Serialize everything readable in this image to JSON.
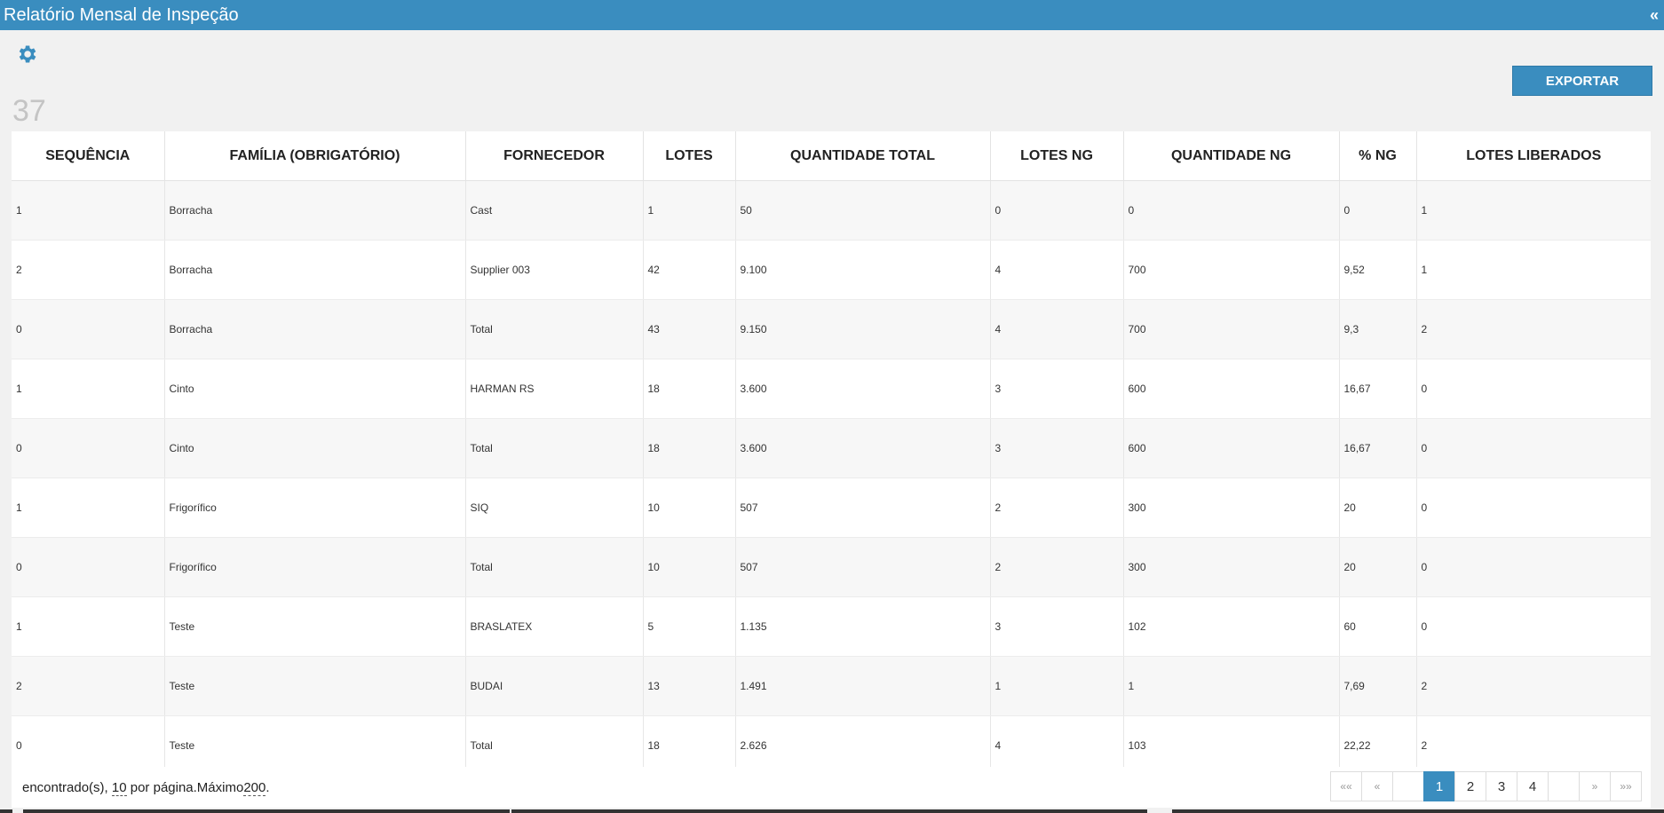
{
  "window": {
    "title": "Relatório Mensal de Inspeção",
    "collapse_glyph": "«"
  },
  "toolbar": {
    "settings_icon": "gear-icon",
    "export_label": "EXPORTAR"
  },
  "result_count": "37",
  "table": {
    "columns": [
      "SEQUÊNCIA",
      "FAMÍLIA (OBRIGATÓRIO)",
      "FORNECEDOR",
      "LOTES",
      "QUANTIDADE TOTAL",
      "LOTES NG",
      "QUANTIDADE NG",
      "% NG",
      "LOTES LIBERADOS"
    ],
    "rows": [
      [
        "1",
        "Borracha",
        "Cast",
        "1",
        "50",
        "0",
        "0",
        "0",
        "1"
      ],
      [
        "2",
        "Borracha",
        "Supplier 003",
        "42",
        "9.100",
        "4",
        "700",
        "9,52",
        "1"
      ],
      [
        "0",
        "Borracha",
        "Total",
        "43",
        "9.150",
        "4",
        "700",
        "9,3",
        "2"
      ],
      [
        "1",
        "Cinto",
        "HARMAN RS",
        "18",
        "3.600",
        "3",
        "600",
        "16,67",
        "0"
      ],
      [
        "0",
        "Cinto",
        "Total",
        "18",
        "3.600",
        "3",
        "600",
        "16,67",
        "0"
      ],
      [
        "1",
        "Frigorífico",
        "SIQ",
        "10",
        "507",
        "2",
        "300",
        "20",
        "0"
      ],
      [
        "0",
        "Frigorífico",
        "Total",
        "10",
        "507",
        "2",
        "300",
        "20",
        "0"
      ],
      [
        "1",
        "Teste",
        "BRASLATEX",
        "5",
        "1.135",
        "3",
        "102",
        "60",
        "0"
      ],
      [
        "2",
        "Teste",
        "BUDAI",
        "13",
        "1.491",
        "1",
        "1",
        "7,69",
        "2"
      ],
      [
        "0",
        "Teste",
        "Total",
        "18",
        "2.626",
        "4",
        "103",
        "22,22",
        "2"
      ]
    ]
  },
  "footer": {
    "found_text": "encontrado(s),",
    "page_size": "10",
    "per_page_text": "por página.Máximo",
    "max": "200",
    "period": "."
  },
  "pagination": {
    "first": "««",
    "prev": "«",
    "pages": [
      "1",
      "2",
      "3",
      "4"
    ],
    "active_page": "1",
    "next": "»",
    "last": "»»"
  },
  "colors": {
    "accent": "#3a8dbf",
    "background": "#f1f1f1"
  }
}
